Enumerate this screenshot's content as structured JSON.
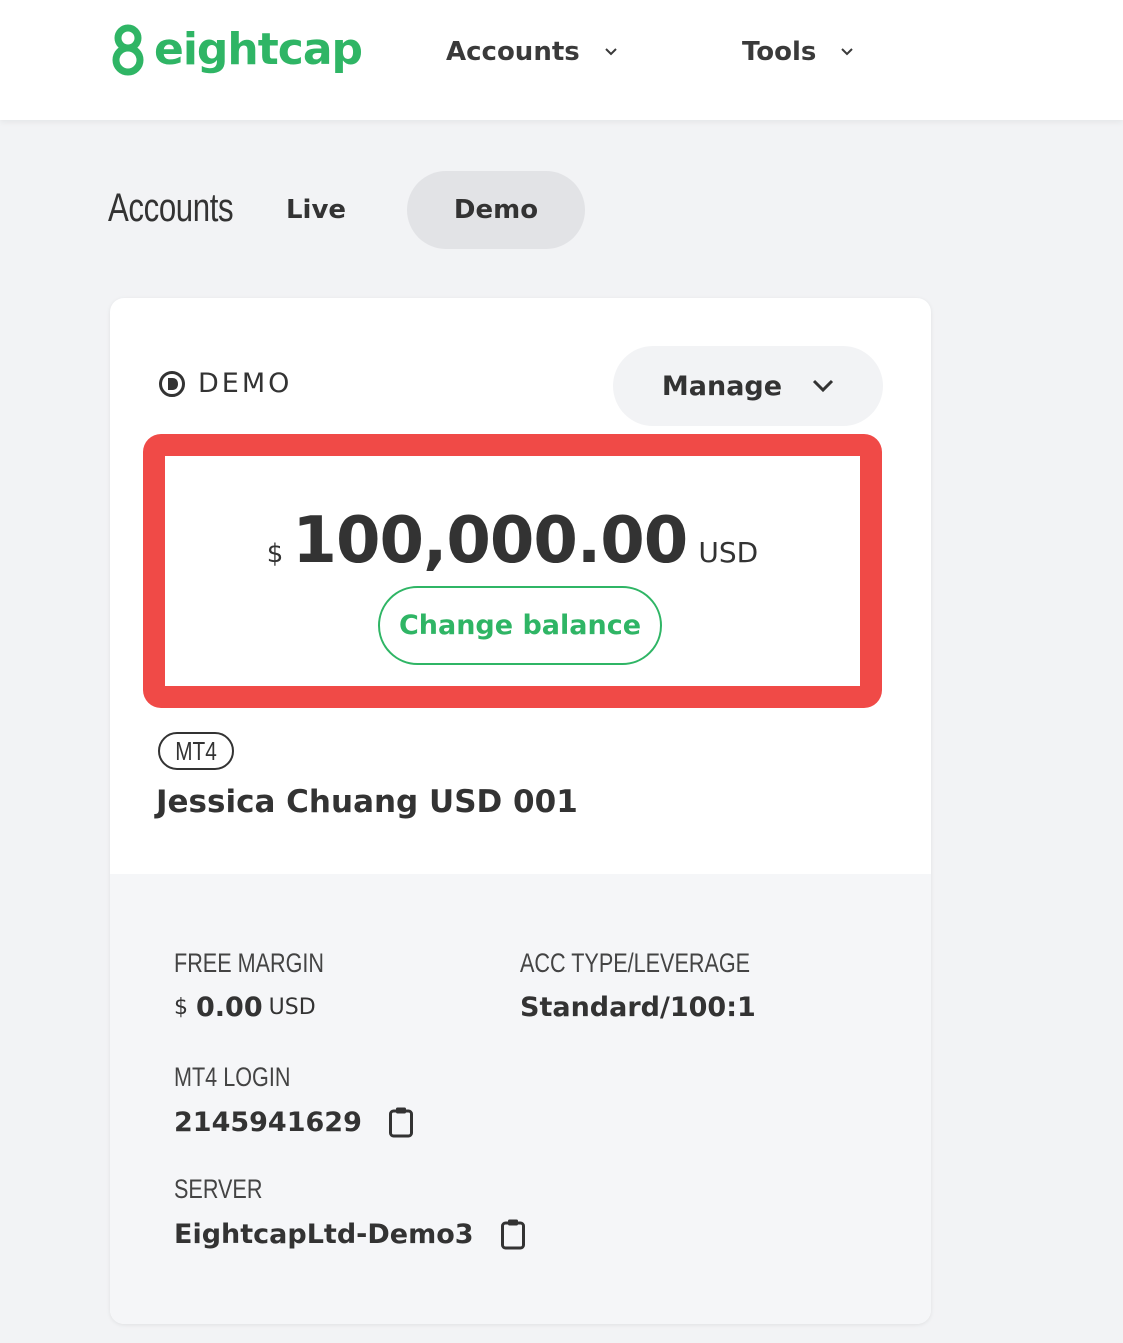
{
  "header": {
    "logo_text": "eightcap",
    "nav": [
      {
        "label": "Accounts"
      },
      {
        "label": "Tools"
      }
    ]
  },
  "tabs": {
    "title": "Accounts",
    "items": [
      {
        "label": "Live",
        "active": false
      },
      {
        "label": "Demo",
        "active": true
      }
    ]
  },
  "card": {
    "type_label": "DEMO",
    "manage_label": "Manage",
    "balance": {
      "currency_symbol": "$",
      "amount": "100,000.00",
      "unit": "USD"
    },
    "change_balance_label": "Change balance",
    "platform": "MT4",
    "account_name": "Jessica Chuang USD 001",
    "details": {
      "free_margin_label": "FREE MARGIN",
      "free_margin_symbol": "$",
      "free_margin_value": "0.00",
      "free_margin_unit": "USD",
      "acc_type_label": "ACC TYPE/LEVERAGE",
      "acc_type_value": "Standard/100:1",
      "login_label": "MT4 LOGIN",
      "login_value": "2145941629",
      "server_label": "SERVER",
      "server_value": "EightcapLtd-Demo3"
    }
  },
  "colors": {
    "brand_green": "#2fb565",
    "highlight_red": "#f04a47",
    "text_dark": "#333333",
    "page_bg": "#f2f3f5"
  },
  "icons": [
    "eightcap-logo-icon",
    "chevron-down-icon",
    "demo-play-icon",
    "clipboard-icon"
  ]
}
